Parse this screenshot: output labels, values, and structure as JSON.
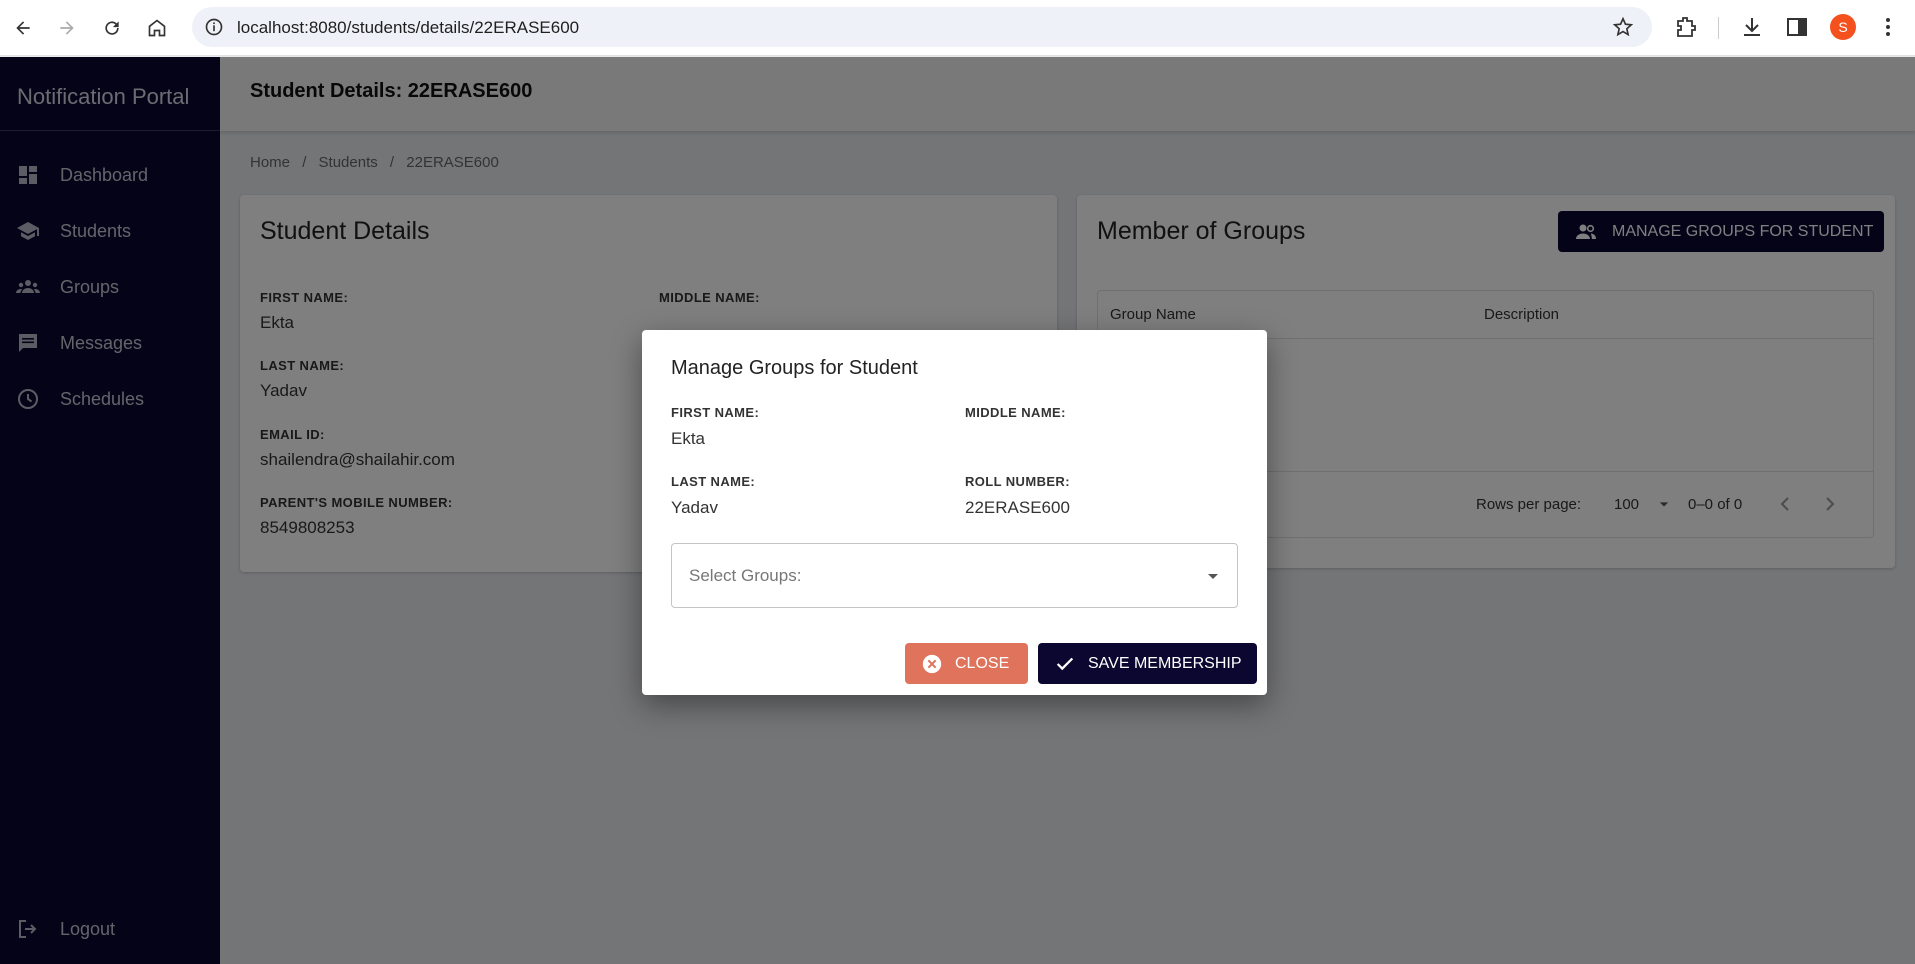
{
  "browser": {
    "url": "localhost:8080/students/details/22ERASE600",
    "profile_initial": "S"
  },
  "sidebar": {
    "brand": "Notification Portal",
    "items": [
      {
        "label": "Dashboard",
        "icon": "dashboard-icon"
      },
      {
        "label": "Students",
        "icon": "school-icon"
      },
      {
        "label": "Groups",
        "icon": "groups-icon"
      },
      {
        "label": "Messages",
        "icon": "message-icon"
      },
      {
        "label": "Schedules",
        "icon": "clock-icon"
      }
    ],
    "logout": "Logout"
  },
  "header": {
    "title": "Student Details: 22ERASE600"
  },
  "breadcrumb": [
    "Home",
    "/",
    "Students",
    "/",
    "22ERASE600"
  ],
  "details_card": {
    "title": "Student Details",
    "first_name_label": "FIRST NAME:",
    "first_name": "Ekta",
    "middle_name_label": "MIDDLE NAME:",
    "last_name_label": "LAST NAME:",
    "last_name": "Yadav",
    "email_label": "EMAIL ID:",
    "email": "shailendra@shailahir.com",
    "mobile_label": "PARENT'S MOBILE NUMBER:",
    "mobile": "8549808253"
  },
  "groups_card": {
    "title": "Member of Groups",
    "manage_button": "MANAGE GROUPS FOR STUDENT",
    "columns": [
      "Group Name",
      "Description"
    ],
    "rows_per_page_label": "Rows per page:",
    "rows_per_page": "100",
    "pagination": "0–0 of 0"
  },
  "modal": {
    "title": "Manage Groups for Student",
    "first_name_label": "FIRST NAME:",
    "first_name": "Ekta",
    "middle_name_label": "MIDDLE NAME:",
    "last_name_label": "LAST NAME:",
    "last_name": "Yadav",
    "roll_label": "ROLL NUMBER:",
    "roll": "22ERASE600",
    "select_placeholder": "Select Groups:",
    "close_button": "CLOSE",
    "save_button": "SAVE MEMBERSHIP"
  },
  "colors": {
    "brand_navy": "#0b0730",
    "close_button": "#e0735b",
    "profile": "#f4511e"
  }
}
